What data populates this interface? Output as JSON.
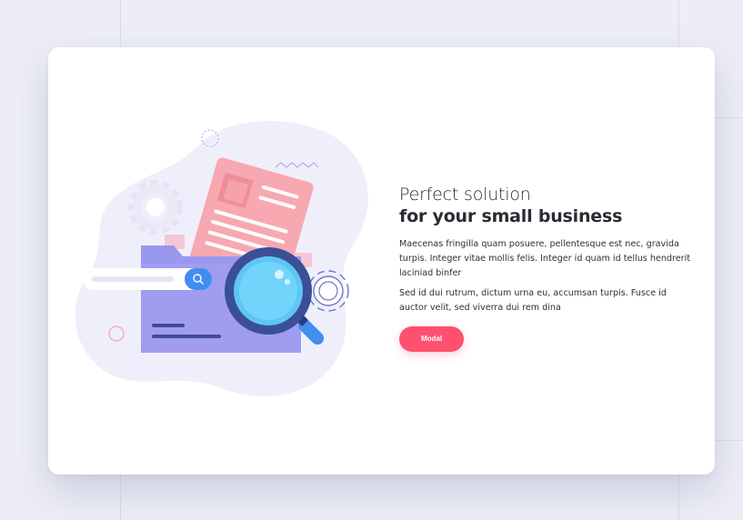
{
  "hero": {
    "title_line1": "Perfect solution",
    "title_line2": "for your small business",
    "paragraph1": "Maecenas fringilla quam posuere, pellentesque est nec, gravida turpis. Integer vitae mollis felis. Integer id quam id tellus hendrerit laciniad binfer",
    "paragraph2": "Sed id dui rutrum, dictum urna eu, accumsan turpis. Fusce id auctor velit, sed viverra dui rem dina",
    "button_label": "Modal"
  },
  "illustration": {
    "icons": [
      "gear-icon",
      "document-icon",
      "folder-icon",
      "magnifier-icon",
      "search-icon"
    ]
  },
  "colors": {
    "accent": "#ff5070",
    "blob": "#efeffb",
    "folder": "#9a97ee",
    "document": "#f7a8b0",
    "magnifier_ring": "#3b4f96",
    "magnifier_lens": "#5ec6f5",
    "search_button": "#3f8ef0"
  }
}
